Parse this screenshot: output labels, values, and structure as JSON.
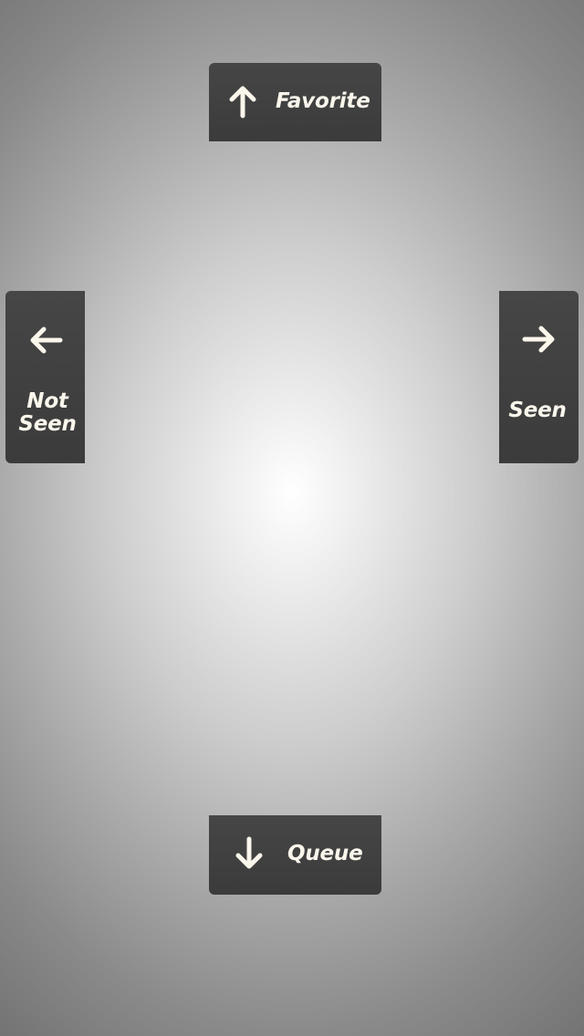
{
  "swipe_actions": {
    "up": {
      "label": "Favorite",
      "icon": "arrow-up-icon"
    },
    "down": {
      "label": "Queue",
      "icon": "arrow-down-icon"
    },
    "left": {
      "label_line1": "Not",
      "label_line2": "Seen",
      "icon": "arrow-left-icon"
    },
    "right": {
      "label": "Seen",
      "icon": "arrow-right-icon"
    }
  },
  "colors": {
    "card_background": "#424242",
    "label_text": "#fbf6ec",
    "backdrop_center": "#ffffff",
    "backdrop_edge": "#707070"
  }
}
